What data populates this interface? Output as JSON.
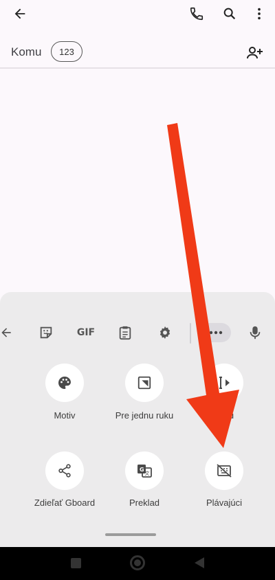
{
  "header": {
    "icons": [
      "back-arrow-icon",
      "phone-icon",
      "search-icon",
      "more-vert-icon"
    ]
  },
  "recipient": {
    "to_label": "Komu",
    "chip_label": "123",
    "add_contact_icon": "person-add-icon"
  },
  "keyboard_toolbar": {
    "gif_label": "GIF",
    "icons": [
      "back-arrow-icon",
      "sticker-icon",
      "clipboard-icon",
      "gear-icon",
      "more-horiz-icon",
      "mic-icon"
    ]
  },
  "keyboard_tiles": [
    {
      "label": "Motiv",
      "icon": "palette-icon"
    },
    {
      "label": "Pre jednu ruku",
      "icon": "one-hand-icon"
    },
    {
      "label": "textu",
      "icon": "text-edit-icon"
    },
    {
      "label": "Zdieľať Gboard",
      "icon": "share-icon"
    },
    {
      "label": "Preklad",
      "icon": "translate-icon"
    },
    {
      "label": "Plávajúci",
      "icon": "floating-keyboard-icon"
    }
  ],
  "annotation": {
    "arrow_color": "#f03a17"
  },
  "colors": {
    "page_background": "#fcf8fc",
    "keyboard_background": "#ecebec",
    "nav_bar": "#000000"
  }
}
